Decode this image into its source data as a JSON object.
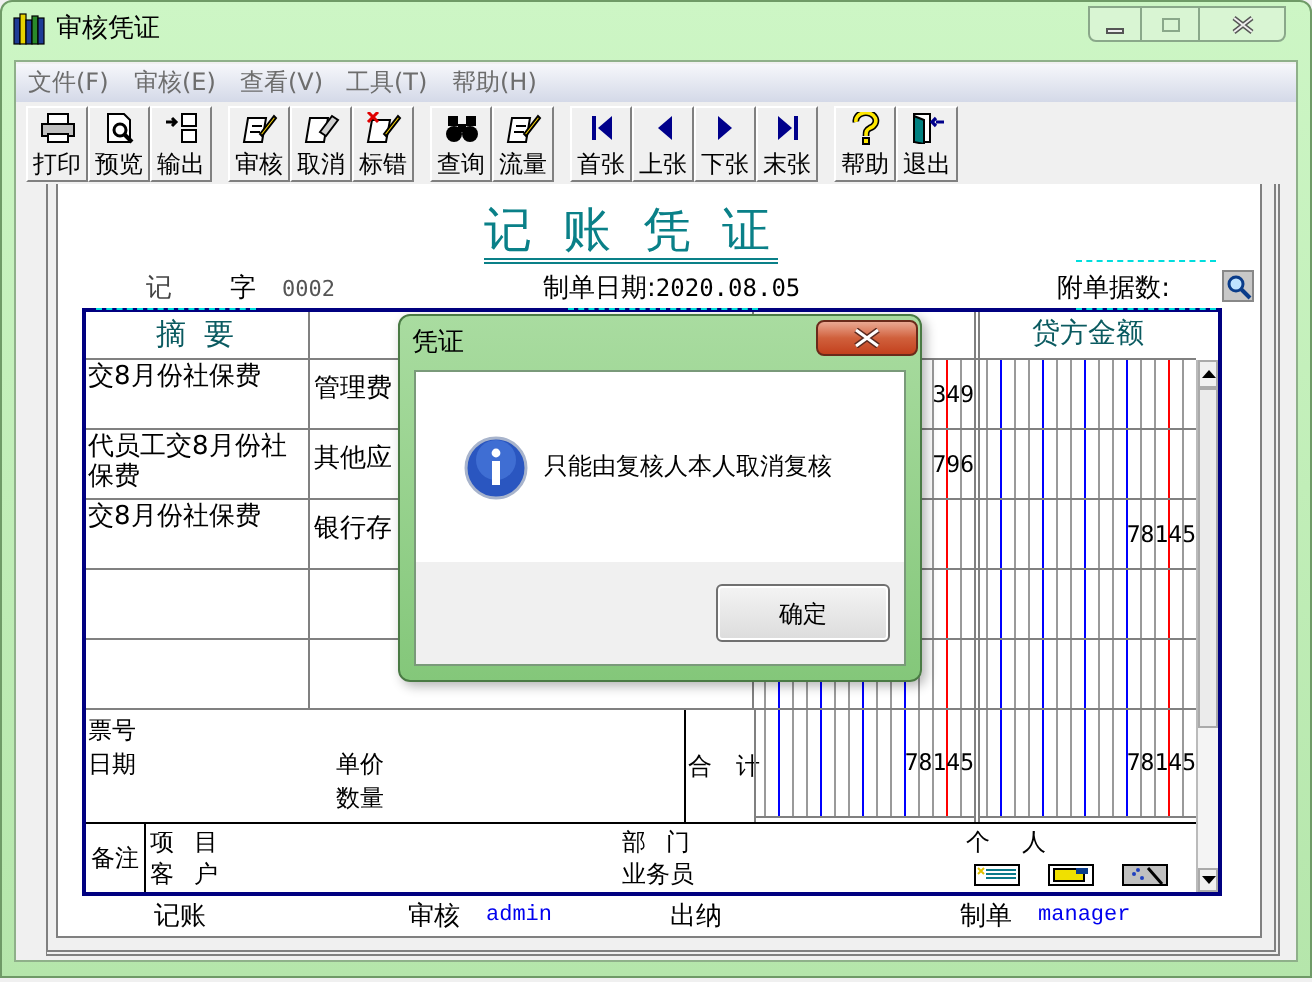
{
  "window": {
    "title": "审核凭证"
  },
  "menu": [
    {
      "label": "文件(F)",
      "disabled": true
    },
    {
      "label": "审核(E)",
      "disabled": true
    },
    {
      "label": "查看(V)",
      "disabled": true
    },
    {
      "label": "工具(T)",
      "disabled": true
    },
    {
      "label": "帮助(H)",
      "disabled": true
    }
  ],
  "toolbar": [
    {
      "buttons": [
        {
          "label": "打印",
          "kind": "print"
        },
        {
          "label": "预览",
          "kind": "preview"
        },
        {
          "label": "输出",
          "kind": "export"
        }
      ]
    },
    {
      "buttons": [
        {
          "label": "审核",
          "kind": "audit"
        },
        {
          "label": "取消",
          "kind": "cancel"
        },
        {
          "label": "标错",
          "kind": "mark"
        }
      ]
    },
    {
      "buttons": [
        {
          "label": "查询",
          "kind": "find"
        },
        {
          "label": "流量",
          "kind": "flow"
        }
      ]
    },
    {
      "buttons": [
        {
          "label": "首张",
          "kind": "first"
        },
        {
          "label": "上张",
          "kind": "prev"
        },
        {
          "label": "下张",
          "kind": "next"
        },
        {
          "label": "末张",
          "kind": "last"
        }
      ]
    },
    {
      "buttons": [
        {
          "label": "帮助",
          "kind": "help"
        },
        {
          "label": "退出",
          "kind": "exit"
        }
      ]
    }
  ],
  "voucher": {
    "title": "记 账 凭 证",
    "type": "记",
    "type_suffix": "字",
    "number": "0002",
    "date_label": "制单日期:",
    "date": "2020.08.05",
    "attachments_label": "附单据数:",
    "summary_header": "摘 要",
    "credit_header": "贷方金额",
    "rows": [
      {
        "summary": "交8月份社保费",
        "account": "管理费",
        "debit": "349"
      },
      {
        "summary": "代员工交8月份社保费",
        "account": "其他应",
        "debit": "796"
      },
      {
        "summary": "交8月份社保费",
        "account": "银行存",
        "credit": "78145"
      },
      {},
      {}
    ],
    "ticket_label": "票号",
    "date_field_label": "日期",
    "unit_price_label": "单价",
    "quantity_label": "数量",
    "total_label": "合 计",
    "debit_total": "78145",
    "credit_total": "78145",
    "notes": {
      "label": "备注",
      "project_label": "项 目",
      "customer_label": "客 户",
      "department_label": "部 门",
      "salesperson_label": "业务员",
      "person_label": "个 人"
    },
    "signatures": [
      {
        "label": "记账"
      },
      {
        "label": "审核",
        "name": "admin"
      },
      {
        "label": "出纳"
      },
      {
        "label": "制单",
        "name": "manager"
      }
    ]
  },
  "dialog": {
    "title": "凭证",
    "message": "只能由复核人本人取消复核",
    "button": "确定"
  }
}
